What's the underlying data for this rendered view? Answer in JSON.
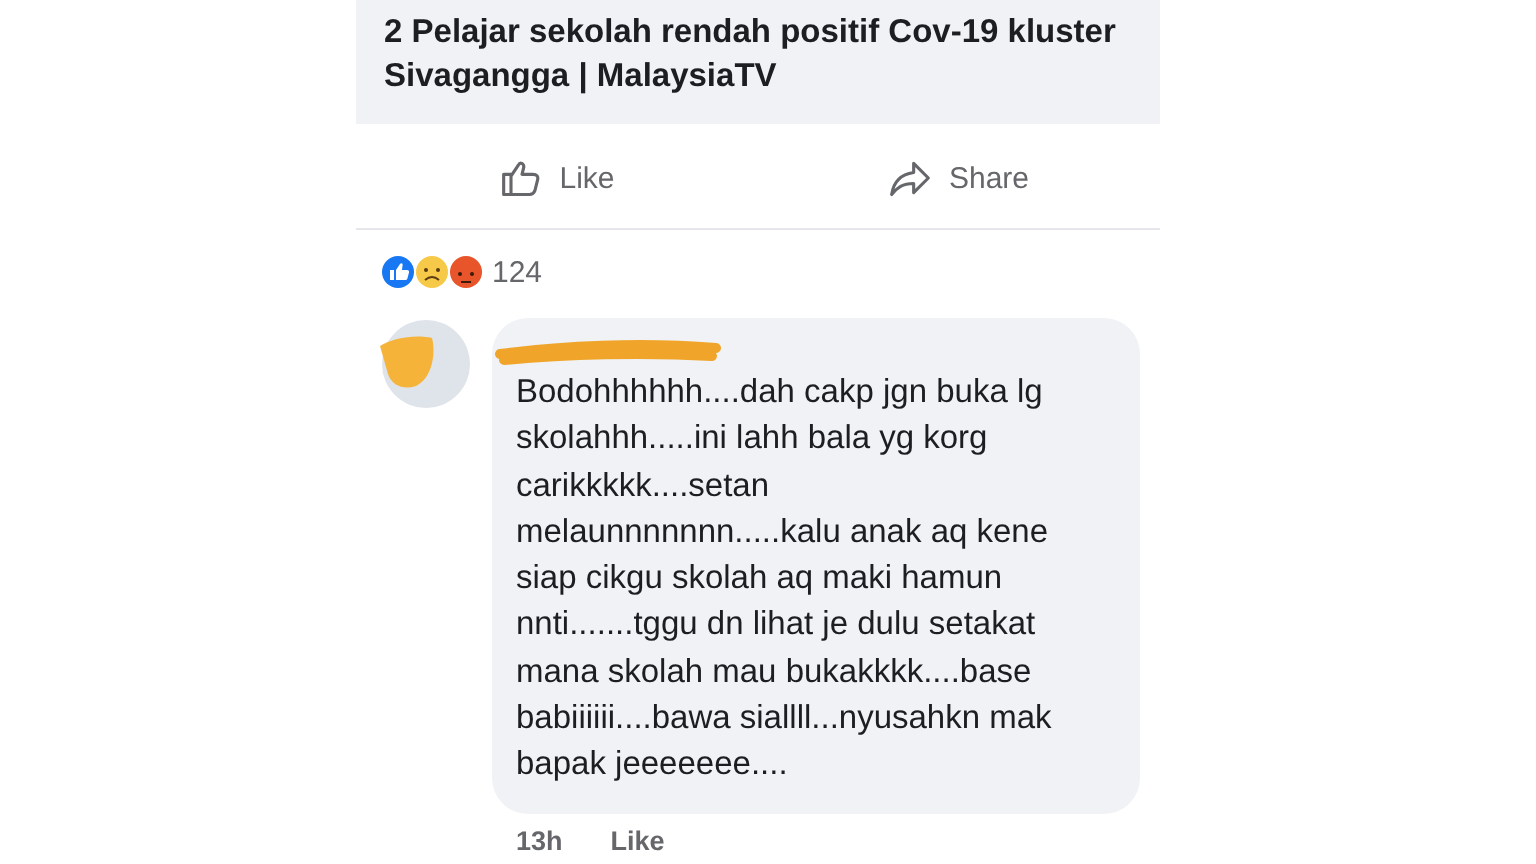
{
  "link_preview": {
    "title": "2 Pelajar sekolah rendah positif Cov-19 kluster Sivagangga | MalaysiaTV"
  },
  "actions": [
    {
      "kind": "like",
      "label": "Like"
    },
    {
      "kind": "share",
      "label": "Share"
    }
  ],
  "reactions": {
    "count": "124"
  },
  "comment": {
    "text": "Bodohhhhhh....dah cakp jgn buka lg\nskolahhh.....ini lahh bala yg korg\ncarikkkkk....setan\nmelaunnnnnnn.....kalu anak aq kene\nsiap cikgu skolah aq maki hamun\nnnti.......tggu dn lihat je dulu setakat\nmana skolah mau bukakkkk....base\nbabiiiiii....bawa siallll...nyusahkn mak\nbapak jeeeeeee....",
    "time": "13h",
    "like_label": "Like"
  }
}
